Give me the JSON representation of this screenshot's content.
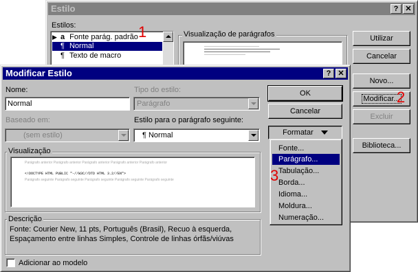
{
  "back_dialog": {
    "title": "Estilo",
    "help_button": "?",
    "close_button": "✕",
    "styles_label": "Estilos:",
    "styles_list": [
      {
        "mark": "a",
        "label": "Fonte parág. padrão"
      },
      {
        "mark": "¶",
        "label": "Normal"
      },
      {
        "mark": "¶",
        "label": "Texto de macro"
      }
    ],
    "preview_group_label": "Visualização de parágrafos",
    "buttons": {
      "apply": "Utilizar",
      "cancel": "Cancelar",
      "new": "Novo...",
      "modify": "Modificar...",
      "delete": "Excluir",
      "library": "Biblioteca..."
    }
  },
  "front_dialog": {
    "title": "Modificar Estilo",
    "help_button": "?",
    "close_button": "✕",
    "name_label": "Nome:",
    "name_value": "Normal",
    "style_type_label": "Tipo do estilo:",
    "style_type_value": "Parágrafo",
    "based_on_label": "Baseado em:",
    "based_on_value": "(sem estilo)",
    "next_style_label": "Estilo para o parágrafo seguinte:",
    "next_style_value": "¶ Normal",
    "preview_label": "Visualização",
    "preview_text": {
      "prev_line": "Parágrafo anterior Parágrafo anterior Parágrafo anterior Parágrafo anterior Parágrafo anterior",
      "sample": "<!DOCTYPE HTML PUBLIC \"-//W3C//DTD HTML 3.2//EN\">",
      "next_line": "Parágrafo seguinte Parágrafo seguinte Parágrafo seguinte Parágrafo seguinte Parágrafo seguinte"
    },
    "description_label": "Descrição",
    "description_line1": "Fonte: Courier New, 11 pts, Português (Brasil), Recuo à esquerda,",
    "description_line2": "Espaçamento entre linhas Simples, Controle de linhas órfãs/viúvas",
    "add_to_template_label": "Adicionar ao modelo",
    "add_to_template_checked": false,
    "buttons": {
      "ok": "OK",
      "cancel": "Cancelar",
      "format": "Formatar"
    }
  },
  "format_menu": {
    "items": [
      "Fonte...",
      "Parágrafo...",
      "Tabulação...",
      "Borda...",
      "Idioma...",
      "Moldura...",
      "Numeração..."
    ],
    "selected_index": 1
  },
  "annotations": {
    "step1": "1",
    "step2": "2",
    "step3": "3",
    "color": "#e00000"
  }
}
